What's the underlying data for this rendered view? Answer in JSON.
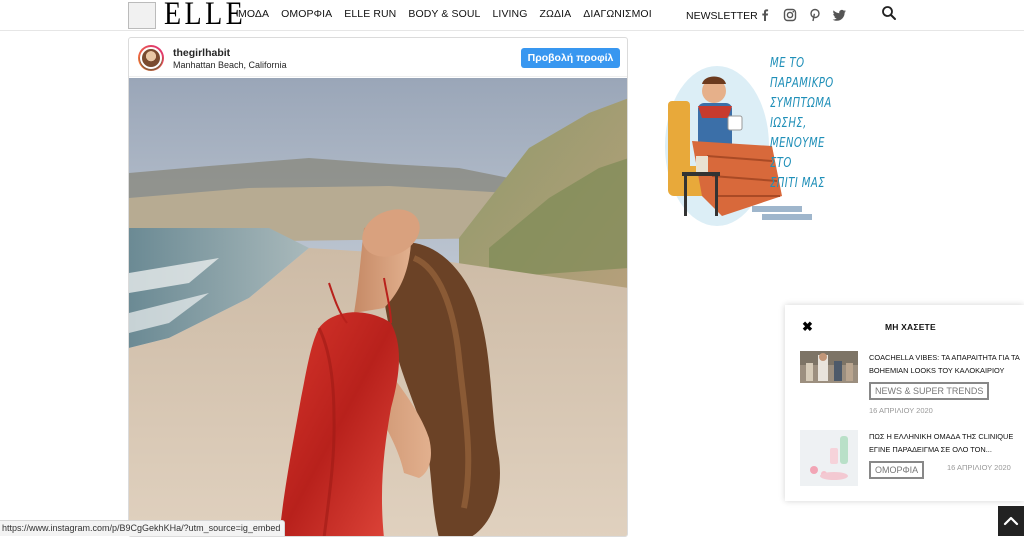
{
  "header": {
    "logo": "ELLE",
    "nav": [
      "ΜΟΔΑ",
      "ΟΜΟΡΦΙΑ",
      "ELLE RUN",
      "BODY & SOUL",
      "LIVING",
      "ΖΩΔΙΑ",
      "ΔΙΑΓΩΝΙΣΜΟΙ"
    ],
    "newsletter": "NEWSLETTER",
    "social_icons": [
      "facebook-icon",
      "instagram-icon",
      "pinterest-icon",
      "twitter-icon"
    ]
  },
  "instagram_embed": {
    "username": "thegirlhabit",
    "location": "Manhattan Beach, California",
    "profile_button": "Προβολή προφίλ"
  },
  "ad": {
    "text": "ΜΕ ΤΟ ΠΑΡΑΜΙΚΡΟ ΣΥΜΠΤΩΜΑ ΙΩΣΗΣ, ΜΕΝΟΥΜΕ ΣΤΟ ΣΠΙΤΙ ΜΑΣ"
  },
  "popup": {
    "title": "ΜΗ ΧΑΣΕΤΕ",
    "posts": [
      {
        "title": "COACHELLA VIBES: ΤΑ ΑΠΑΡΑΙΤΗΤΑ ΓΙΑ ΤΑ BOHEMIAN LOOKS ΤΟΥ ΚΑΛΟΚΑΙΡΙΟΥ",
        "category": "NEWS & SUPER TRENDS",
        "date": "16 ΑΠΡΙΛΙΟΥ 2020"
      },
      {
        "title": "ΠΩΣ Η ΕΛΛΗΝΙΚΗ ΟΜΑΔΑ ΤΗΣ CLINIQUE ΕΓΙΝΕ ΠΑΡΑΔΕΙΓΜΑ ΣΕ ΟΛΟ ΤΟΝ...",
        "category": "ΟΜΟΡΦΙΑ",
        "date": "16 ΑΠΡΙΛΙΟΥ 2020"
      }
    ]
  },
  "status_url": "https://www.instagram.com/p/B9CgGekhKHa/?utm_source=ig_embed",
  "colors": {
    "instagram_button": "#3897f0",
    "ad_text": "#1f8fb8"
  }
}
